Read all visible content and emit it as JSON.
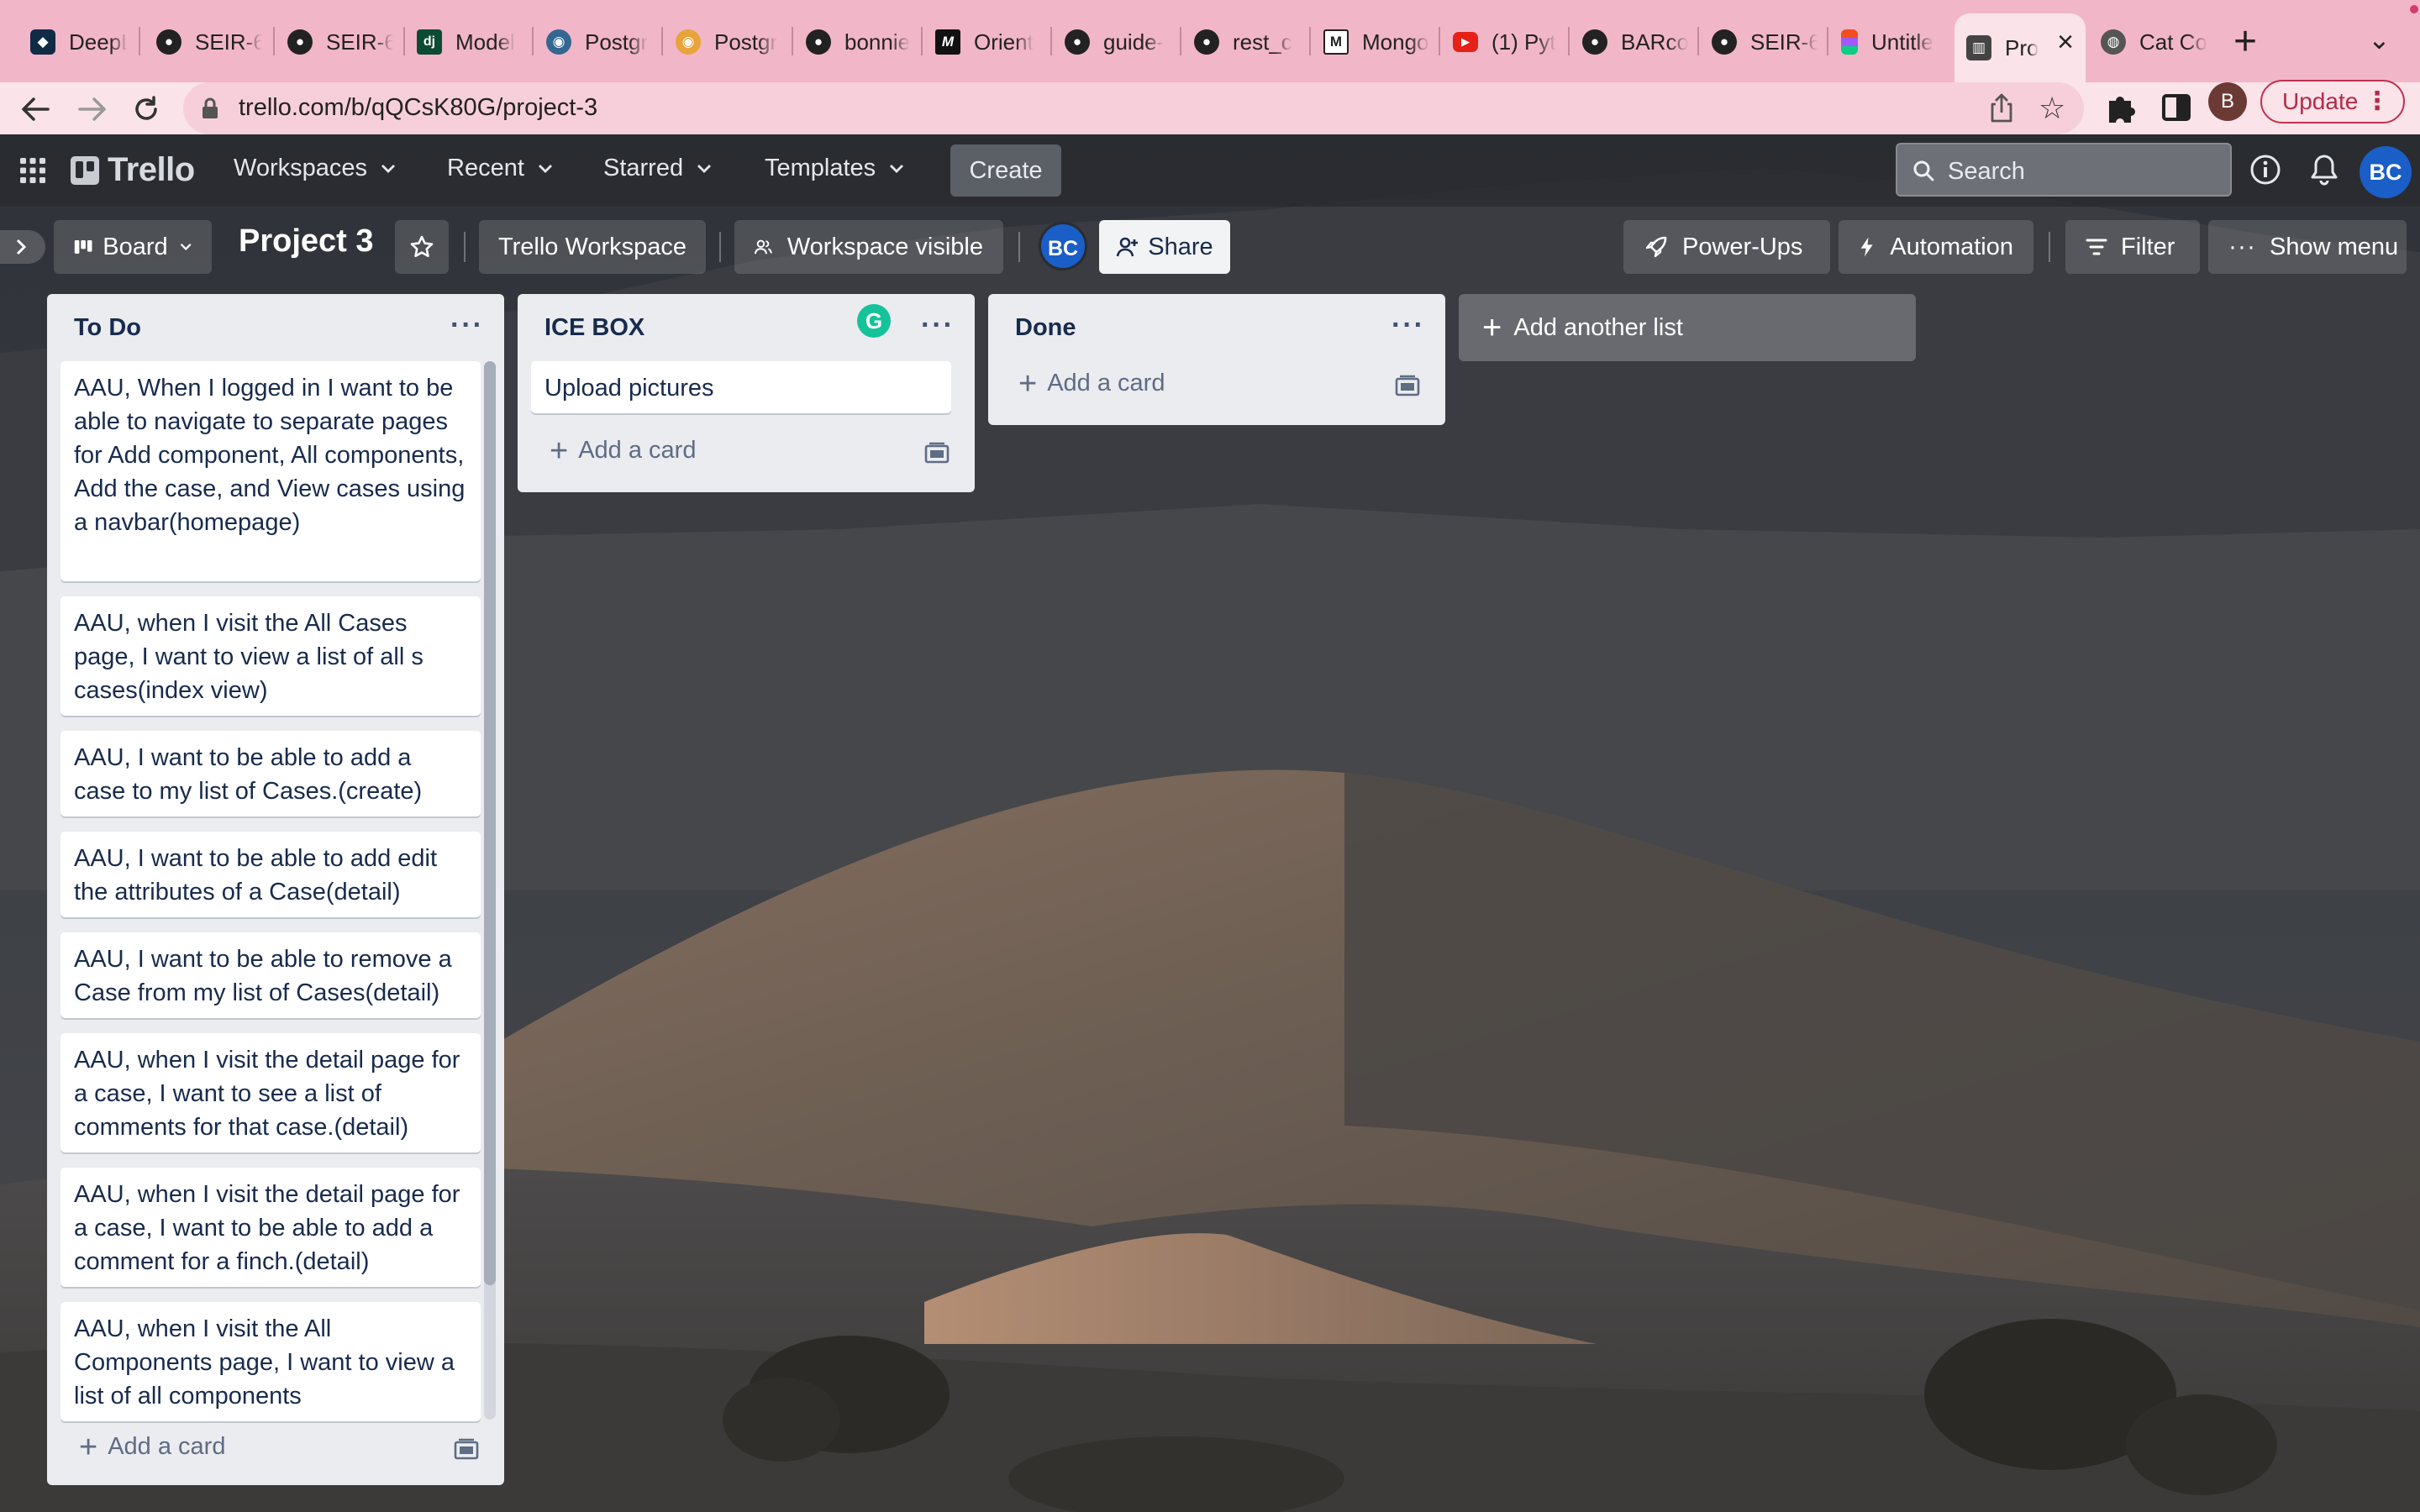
{
  "browser": {
    "tabs": [
      {
        "title": "DeepL",
        "icon": "deepl-icon",
        "color": "#0f2b46"
      },
      {
        "title": "SEIR-6",
        "icon": "github-icon",
        "color": "#222222"
      },
      {
        "title": "SEIR-6",
        "icon": "github-icon",
        "color": "#222222"
      },
      {
        "title": "Model",
        "icon": "django-icon",
        "color": "#0c4b33"
      },
      {
        "title": "Postgr",
        "icon": "postgres-icon",
        "color": "#336791"
      },
      {
        "title": "Postgr",
        "icon": "postgres-icon",
        "color": "#e8a33a"
      },
      {
        "title": "bonnie",
        "icon": "github-icon",
        "color": "#222222"
      },
      {
        "title": "Orient",
        "icon": "medium-icon",
        "color": "#111111"
      },
      {
        "title": "guide-",
        "icon": "github-icon",
        "color": "#222222"
      },
      {
        "title": "rest_c",
        "icon": "github-icon",
        "color": "#222222"
      },
      {
        "title": "Mongo",
        "icon": "medium-icon",
        "color": "#ffffff"
      },
      {
        "title": "(1) Pyt",
        "icon": "youtube-icon",
        "color": "#e62117"
      },
      {
        "title": "BARco",
        "icon": "github-icon",
        "color": "#222222"
      },
      {
        "title": "SEIR-6",
        "icon": "github-icon",
        "color": "#222222"
      },
      {
        "title": "Untitle",
        "icon": "figma-icon",
        "color": "#f24e1e"
      },
      {
        "title": "Pro",
        "icon": "trello-icon",
        "color": "#444444",
        "active": true
      },
      {
        "title": "Cat Co",
        "icon": "globe-icon",
        "color": "#555555"
      }
    ],
    "url": "trello.com/b/qQCsK80G/project-3",
    "profile_initial": "B",
    "update_label": "Update"
  },
  "trello": {
    "logo": "Trello",
    "nav": {
      "workspaces": "Workspaces",
      "recent": "Recent",
      "starred": "Starred",
      "templates": "Templates",
      "create": "Create"
    },
    "search_placeholder": "Search",
    "user_initials": "BC"
  },
  "board": {
    "view": "Board",
    "title": "Project 3",
    "workspace": "Trello Workspace",
    "visibility": "Workspace visible",
    "member_initials": "BC",
    "share": "Share",
    "power_ups": "Power-Ups",
    "automation": "Automation",
    "filter": "Filter",
    "show_menu": "Show menu",
    "add_list": "Add another list"
  },
  "lists": [
    {
      "title": "To Do",
      "add_card": "Add a card",
      "cards": [
        "AAU, When I logged in I want to be able to navigate to separate pages for Add component, All components, Add the case, and View cases using a navbar(homepage)",
        "AAU, when I visit the All Cases page, I want to view a list of all s cases(index view)",
        "AAU, I want to be able to add a case to my list of Cases.(create)",
        "AAU, I want to be able to add edit the attributes of a Case(detail)",
        "AAU, I want to be able to remove a Case from my list of Cases(detail)",
        "AAU, when I visit the detail page for a case, I want to see a list of comments for that case.(detail)",
        "AAU, when I visit the detail page for a case, I want to be able to add a comment for a finch.(detail)",
        "AAU, when I visit the All Components page, I want to view a list of all components"
      ]
    },
    {
      "title": "ICE BOX",
      "add_card": "Add a card",
      "cards": [
        "Upload pictures"
      ]
    },
    {
      "title": "Done",
      "add_card": "Add a card",
      "cards": []
    }
  ],
  "extension_badge": "G",
  "colors": {
    "tabbar": "#f2b6c9",
    "toolbar": "#fbe3ea",
    "list_bg": "#ebecf0",
    "avatar_blue": "#1a5ec7",
    "grammarly": "#15c39a"
  }
}
